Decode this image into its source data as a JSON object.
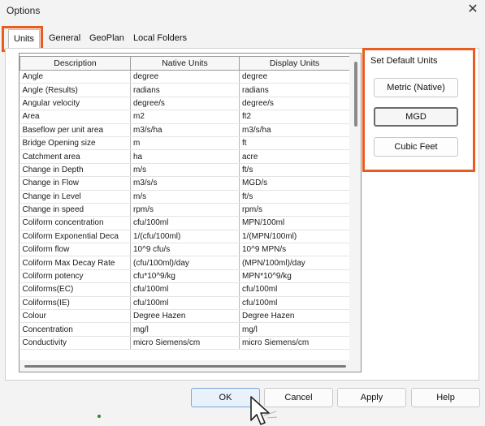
{
  "window": {
    "title": "Options",
    "close_glyph": "✕"
  },
  "tabs": [
    {
      "label": "Units",
      "active": true
    },
    {
      "label": "General"
    },
    {
      "label": "GeoPlan"
    },
    {
      "label": "Local Folders"
    }
  ],
  "grid": {
    "columns": [
      "Description",
      "Native Units",
      "Display Units"
    ],
    "rows": [
      [
        "Angle",
        "degree",
        "degree"
      ],
      [
        "Angle (Results)",
        "radians",
        "radians"
      ],
      [
        "Angular velocity",
        "degree/s",
        "degree/s"
      ],
      [
        "Area",
        "m2",
        "ft2"
      ],
      [
        "Baseflow per unit area",
        "m3/s/ha",
        "m3/s/ha"
      ],
      [
        "Bridge Opening size",
        "m",
        "ft"
      ],
      [
        "Catchment area",
        "ha",
        "acre"
      ],
      [
        "Change in Depth",
        "m/s",
        "ft/s"
      ],
      [
        "Change in Flow",
        "m3/s/s",
        "MGD/s"
      ],
      [
        "Change in Level",
        "m/s",
        "ft/s"
      ],
      [
        "Change in speed",
        "rpm/s",
        "rpm/s"
      ],
      [
        "Coliform concentration",
        "cfu/100ml",
        "MPN/100ml"
      ],
      [
        "Coliform Exponential Deca",
        "1/(cfu/100ml)",
        "1/(MPN/100ml)"
      ],
      [
        "Coliform flow",
        "10^9 cfu/s",
        "10^9 MPN/s"
      ],
      [
        "Coliform Max Decay Rate",
        "(cfu/100ml)/day",
        "(MPN/100ml)/day"
      ],
      [
        "Coliform potency",
        "cfu*10^9/kg",
        "MPN*10^9/kg"
      ],
      [
        "Coliforms(EC)",
        "cfu/100ml",
        "cfu/100ml"
      ],
      [
        "Coliforms(IE)",
        "cfu/100ml",
        "cfu/100ml"
      ],
      [
        "Colour",
        "Degree Hazen",
        "Degree Hazen"
      ],
      [
        "Concentration",
        "mg/l",
        "mg/l"
      ],
      [
        "Conductivity",
        "micro Siemens/cm",
        "micro Siemens/cm"
      ]
    ]
  },
  "default_units": {
    "label": "Set Default Units",
    "buttons": [
      "Metric (Native)",
      "MGD",
      "Cubic Feet"
    ]
  },
  "footer": {
    "ok": "OK",
    "cancel": "Cancel",
    "apply": "Apply",
    "help": "Help"
  },
  "colors": {
    "highlight": "#ea5b1f"
  }
}
